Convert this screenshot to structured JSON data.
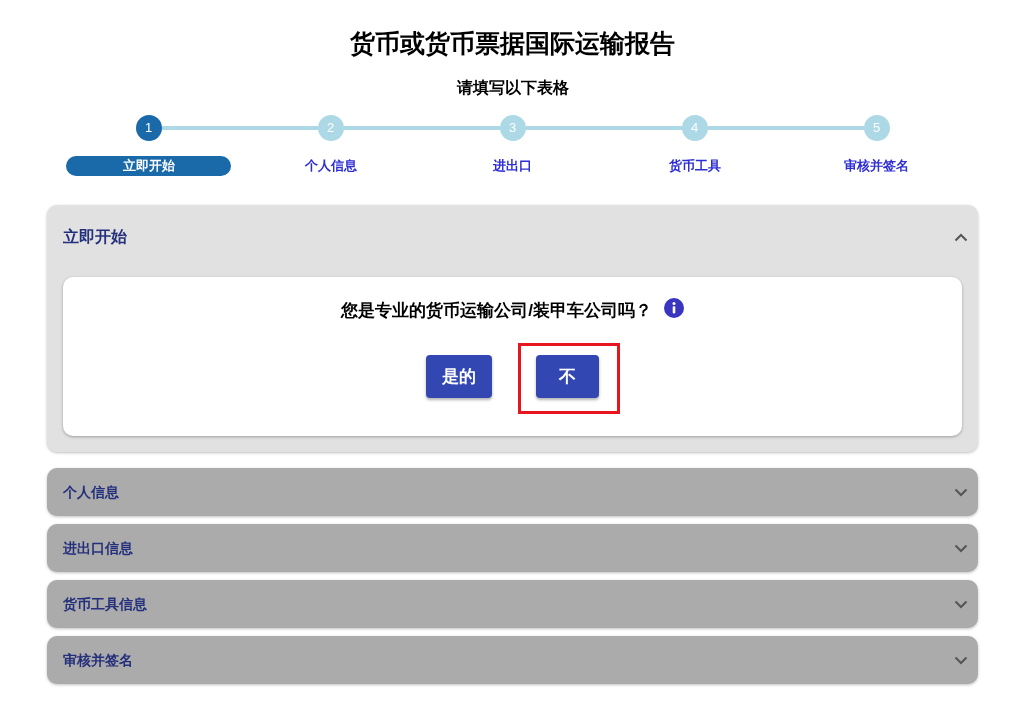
{
  "page": {
    "title": "货币或货币票据国际运输报告",
    "subtitle": "请填写以下表格"
  },
  "stepper": {
    "steps": [
      {
        "number": "1",
        "label": "立即开始",
        "selected": true
      },
      {
        "number": "2",
        "label": "个人信息",
        "selected": false
      },
      {
        "number": "3",
        "label": "进出口",
        "selected": false
      },
      {
        "number": "4",
        "label": "货币工具",
        "selected": false
      },
      {
        "number": "5",
        "label": "审核并签名",
        "selected": false
      }
    ]
  },
  "sections": [
    {
      "title": "立即开始",
      "expanded": true,
      "question": {
        "text": "您是专业的货币运输公司/装甲车公司吗？",
        "answers": [
          {
            "label": "是的",
            "highlighted": false
          },
          {
            "label": "不",
            "highlighted": true
          }
        ]
      }
    },
    {
      "title": "个人信息",
      "expanded": false
    },
    {
      "title": "进出口信息",
      "expanded": false
    },
    {
      "title": "货币工具信息",
      "expanded": false
    },
    {
      "title": "审核并签名",
      "expanded": false
    }
  ]
}
